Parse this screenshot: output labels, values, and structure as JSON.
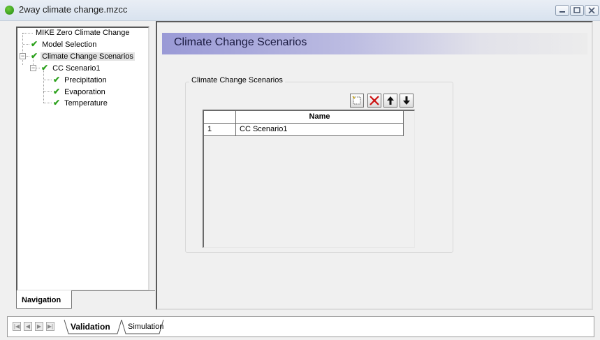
{
  "window": {
    "title": "2way climate change.mzcc",
    "min_icon": "minimize-icon",
    "max_icon": "maximize-icon",
    "close_icon": "close-icon"
  },
  "tree": {
    "root": "MIKE Zero Climate Change",
    "model_selection": "Model Selection",
    "scenarios": "Climate Change Scenarios",
    "scenario1": "CC Scenario1",
    "precipitation": "Precipitation",
    "evaporation": "Evaporation",
    "temperature": "Temperature",
    "check_icon": "checkmark-icon",
    "check_color": "#2aa01a"
  },
  "nav_tab": {
    "label": "Navigation"
  },
  "content": {
    "header": "Climate Change Scenarios",
    "group_label": "Climate Change Scenarios",
    "header_color": "#9a9ad6",
    "toolbar": {
      "new_icon": "new-row-icon",
      "delete_icon": "delete-icon",
      "up_icon": "move-up-icon",
      "down_icon": "move-down-icon",
      "delete_color": "#cc1010"
    },
    "grid": {
      "columns": [
        "",
        "Name"
      ],
      "rows": [
        {
          "index": "1",
          "name": "CC Scenario1"
        }
      ]
    }
  },
  "bottom_tabs": {
    "validation": "Validation",
    "simulation": "Simulation"
  }
}
